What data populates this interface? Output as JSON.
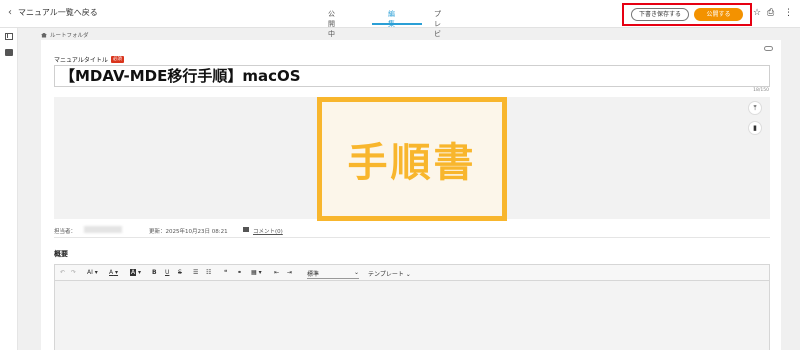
{
  "header": {
    "back_label": "マニュアル一覧へ戻る",
    "tabs": [
      {
        "label": "公開中"
      },
      {
        "label": "編集"
      },
      {
        "label": "プレビュー"
      }
    ],
    "draft_button": "下書き保存する",
    "publish_button": "公開する",
    "accent_color": "#2a9fd6",
    "publish_color": "#f39200",
    "highlight_color": "#e60012"
  },
  "breadcrumb": {
    "label": "ルートフォルダ"
  },
  "manual": {
    "title_label": "マニュアルタイトル",
    "required_badge": "必須",
    "title_value": "【MDAV-MDE移行手順】macOS",
    "char_counter": "18/150",
    "cover_text": "手順書",
    "cover_color": "#f8b62d"
  },
  "meta": {
    "owner_label": "担当者：",
    "updated": "更新：2025年10月23日 08:21",
    "comment_link": "コメント(0)"
  },
  "summary": {
    "label": "概要",
    "toolbar": {
      "font_size": "AI",
      "text_color": "A",
      "bg_color": "A",
      "bold": "B",
      "underline": "U",
      "strike": "S",
      "quote": "❝",
      "style_select": "標準",
      "template_select": "テンプレート"
    }
  },
  "icons": [
    "chevron-left-icon",
    "external-link-icon",
    "star-icon",
    "print-icon",
    "more-vert-icon",
    "toc-icon",
    "comment-icon",
    "home-icon",
    "link-icon",
    "upload-icon",
    "trash-icon"
  ]
}
